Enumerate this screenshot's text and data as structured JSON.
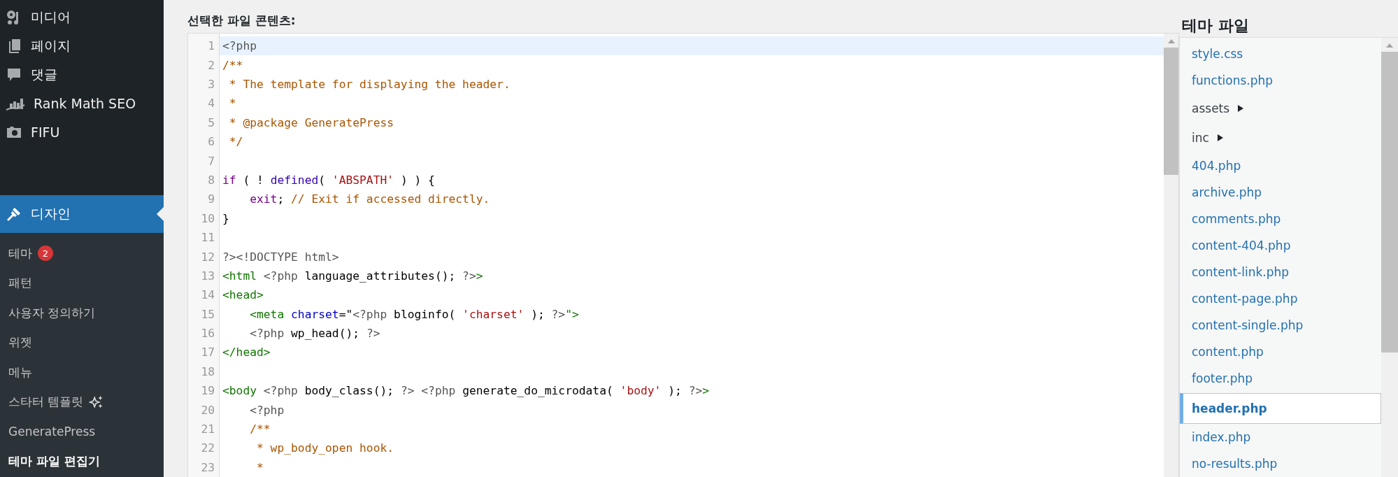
{
  "sidebar": {
    "menu": [
      {
        "label": "미디어",
        "kind": "media",
        "selected": false
      },
      {
        "label": "페이지",
        "kind": "pages",
        "selected": false
      },
      {
        "label": "댓글",
        "kind": "comments",
        "selected": false
      },
      {
        "label": "Rank Math SEO",
        "kind": "chart",
        "selected": false
      },
      {
        "label": "FIFU",
        "kind": "camera",
        "selected": false
      },
      {
        "label": "디자인",
        "kind": "brush",
        "selected": true
      }
    ],
    "submenu": [
      {
        "label": "테마",
        "badge": "2",
        "selected": false
      },
      {
        "label": "패턴",
        "selected": false
      },
      {
        "label": "사용자 정의하기",
        "selected": false
      },
      {
        "label": "위젯",
        "selected": false
      },
      {
        "label": "메뉴",
        "selected": false
      },
      {
        "label": "스타터 템플릿",
        "kind": "sparkle",
        "selected": false
      },
      {
        "label": "GeneratePress",
        "selected": false
      },
      {
        "label": "테마 파일 편집기",
        "selected": true
      }
    ]
  },
  "editor": {
    "title": "선택한 파일 콘텐츠:",
    "lines": [
      {
        "number": "1",
        "selected": true,
        "tokens": [
          {
            "text": "<?php",
            "kind": "php"
          }
        ]
      },
      {
        "number": "2",
        "selected": false,
        "tokens": [
          {
            "text": "/**",
            "kind": "comment"
          }
        ]
      },
      {
        "number": "3",
        "selected": false,
        "tokens": [
          {
            "text": " * The template for displaying the header.",
            "kind": "comment"
          }
        ]
      },
      {
        "number": "4",
        "selected": false,
        "tokens": [
          {
            "text": " *",
            "kind": "comment"
          }
        ]
      },
      {
        "number": "5",
        "selected": false,
        "tokens": [
          {
            "text": " * @package GeneratePress",
            "kind": "comment"
          }
        ]
      },
      {
        "number": "6",
        "selected": false,
        "tokens": [
          {
            "text": " */",
            "kind": "comment"
          }
        ]
      },
      {
        "number": "7",
        "selected": false
      },
      {
        "number": "8",
        "selected": false,
        "tokens": [
          {
            "text": "if",
            "kind": "keyword"
          },
          {
            "text": " ( ! ",
            "kind": "plain"
          },
          {
            "text": "defined",
            "kind": "function"
          },
          {
            "text": "( ",
            "kind": "plain"
          },
          {
            "text": "'ABSPATH'",
            "kind": "string"
          },
          {
            "text": " ) ) {",
            "kind": "plain"
          }
        ]
      },
      {
        "number": "9",
        "selected": false,
        "tokens": [
          {
            "text": "    exit",
            "kind": "keyword"
          },
          {
            "text": "; ",
            "kind": "plain"
          },
          {
            "text": "// Exit if accessed directly.",
            "kind": "comment"
          }
        ]
      },
      {
        "number": "10",
        "selected": false,
        "tokens": [
          {
            "text": "}",
            "kind": "plain"
          }
        ]
      },
      {
        "number": "11",
        "selected": false
      },
      {
        "number": "12",
        "selected": false,
        "tokens": [
          {
            "text": "?><!DOCTYPE html>",
            "kind": "php"
          }
        ]
      },
      {
        "number": "13",
        "selected": false,
        "tokens": [
          {
            "text": "<html",
            "kind": "tag"
          },
          {
            "text": " <?php",
            "kind": "php"
          },
          {
            "text": " language_attributes(); ",
            "kind": "plain"
          },
          {
            "text": "?>",
            "kind": "php"
          },
          {
            "text": ">",
            "kind": "tag"
          }
        ]
      },
      {
        "number": "14",
        "selected": false,
        "tokens": [
          {
            "text": "<head>",
            "kind": "tag"
          }
        ]
      },
      {
        "number": "15",
        "selected": false,
        "tokens": [
          {
            "text": "    <meta",
            "kind": "tag"
          },
          {
            "text": " charset",
            "kind": "attribute"
          },
          {
            "text": "=\"",
            "kind": "plain"
          },
          {
            "text": "<?php",
            "kind": "php"
          },
          {
            "text": " bloginfo( ",
            "kind": "plain"
          },
          {
            "text": "'charset'",
            "kind": "string"
          },
          {
            "text": " ); ",
            "kind": "plain"
          },
          {
            "text": "?>",
            "kind": "php"
          },
          {
            "text": "\">",
            "kind": "tag"
          }
        ]
      },
      {
        "number": "16",
        "selected": false,
        "tokens": [
          {
            "text": "    <?php",
            "kind": "php"
          },
          {
            "text": " wp_head(); ",
            "kind": "plain"
          },
          {
            "text": "?>",
            "kind": "php"
          }
        ]
      },
      {
        "number": "17",
        "selected": false,
        "tokens": [
          {
            "text": "</head>",
            "kind": "tag"
          }
        ]
      },
      {
        "number": "18",
        "selected": false
      },
      {
        "number": "19",
        "selected": false,
        "tokens": [
          {
            "text": "<body",
            "kind": "tag"
          },
          {
            "text": " <?php",
            "kind": "php"
          },
          {
            "text": " body_class(); ",
            "kind": "plain"
          },
          {
            "text": "?>",
            "kind": "php"
          },
          {
            "text": " <?php",
            "kind": "php"
          },
          {
            "text": " generate_do_microdata( ",
            "kind": "plain"
          },
          {
            "text": "'body'",
            "kind": "string"
          },
          {
            "text": " ); ",
            "kind": "plain"
          },
          {
            "text": "?>",
            "kind": "php"
          },
          {
            "text": ">",
            "kind": "tag"
          }
        ]
      },
      {
        "number": "20",
        "selected": false,
        "tokens": [
          {
            "text": "    <?php",
            "kind": "php"
          }
        ]
      },
      {
        "number": "21",
        "selected": false,
        "tokens": [
          {
            "text": "    /**",
            "kind": "comment"
          }
        ]
      },
      {
        "number": "22",
        "selected": false,
        "tokens": [
          {
            "text": "     * wp_body_open hook.",
            "kind": "comment"
          }
        ]
      },
      {
        "number": "23",
        "selected": false,
        "tokens": [
          {
            "text": "     *",
            "kind": "comment"
          }
        ]
      }
    ]
  },
  "theme_files": {
    "title": "테마 파일",
    "files": [
      {
        "name": "style.css",
        "kind": "file",
        "selected": false
      },
      {
        "name": "functions.php",
        "kind": "file",
        "selected": false
      },
      {
        "name": "assets",
        "kind": "folder"
      },
      {
        "name": "inc",
        "kind": "folder"
      },
      {
        "name": "404.php",
        "kind": "file",
        "selected": false
      },
      {
        "name": "archive.php",
        "kind": "file",
        "selected": false
      },
      {
        "name": "comments.php",
        "kind": "file",
        "selected": false
      },
      {
        "name": "content-404.php",
        "kind": "file",
        "selected": false
      },
      {
        "name": "content-link.php",
        "kind": "file",
        "selected": false
      },
      {
        "name": "content-page.php",
        "kind": "file",
        "selected": false
      },
      {
        "name": "content-single.php",
        "kind": "file",
        "selected": false
      },
      {
        "name": "content.php",
        "kind": "file",
        "selected": false
      },
      {
        "name": "footer.php",
        "kind": "file",
        "selected": false
      },
      {
        "name": "header.php",
        "kind": "file",
        "selected": true
      },
      {
        "name": "index.php",
        "kind": "file",
        "selected": false
      },
      {
        "name": "no-results.php",
        "kind": "file",
        "selected": false
      }
    ]
  }
}
